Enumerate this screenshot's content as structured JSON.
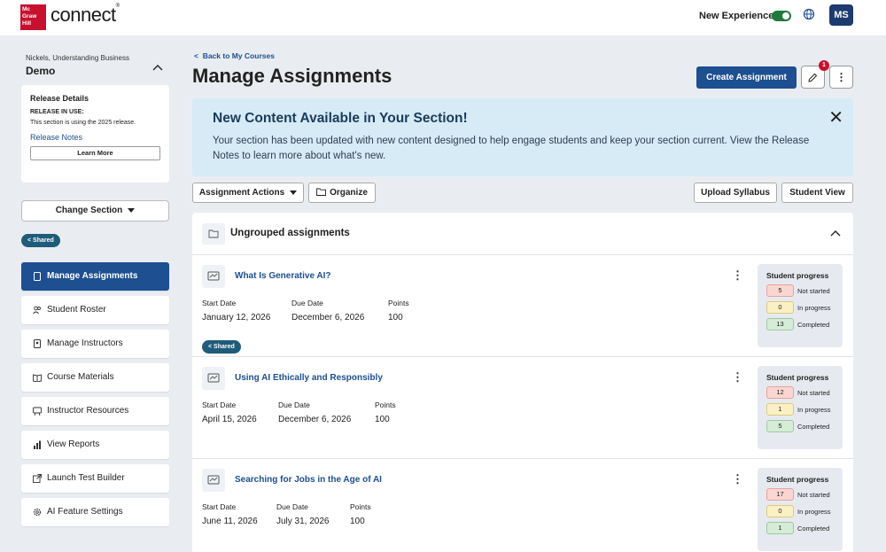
{
  "header": {
    "logo_text": "Mc Graw Hill",
    "brand": "connect",
    "new_experience_label": "New Experience",
    "new_experience_on": true,
    "user_initials": "MS"
  },
  "sidebar": {
    "course_name": "Nickels, Understanding Business",
    "section_name": "Demo",
    "release": {
      "title": "Release Details",
      "in_use_label": "RELEASE IN USE:",
      "in_use_text": "This section is using the 2025 release.",
      "notes_link": "Release Notes",
      "learn_more": "Learn More"
    },
    "change_section": "Change Section",
    "shared_badge": "Shared",
    "items": [
      {
        "label": "Manage Assignments",
        "active": true
      },
      {
        "label": "Student Roster"
      },
      {
        "label": "Manage Instructors"
      },
      {
        "label": "Course Materials"
      },
      {
        "label": "Instructor Resources"
      },
      {
        "label": "View Reports"
      },
      {
        "label": "Launch Test Builder"
      },
      {
        "label": "AI Feature Settings"
      }
    ]
  },
  "main": {
    "back_link": "Back to My Courses",
    "title": "Manage Assignments",
    "create_button": "Create Assignment",
    "notification_count": "1",
    "banner": {
      "title": "New Content Available in Your Section!",
      "body": "Your section has been updated with new content designed to help engage students and keep your section current. View the Release Notes to learn more about what's new."
    },
    "toolbar": {
      "assignment_actions": "Assignment Actions",
      "organize": "Organize",
      "upload_syllabus": "Upload Syllabus",
      "student_view": "Student View"
    },
    "group_title": "Ungrouped assignments",
    "labels": {
      "start_date": "Start Date",
      "due_date": "Due Date",
      "points": "Points",
      "progress_title": "Student progress",
      "not_started": "Not started",
      "in_progress": "In progress",
      "completed": "Completed",
      "shared": "Shared"
    },
    "assignments": [
      {
        "title": "What Is Generative AI?",
        "start": "January 12, 2026",
        "due": "December 6, 2026",
        "points": "100",
        "not_started": "5",
        "in_progress": "0",
        "completed": "13",
        "shared": true
      },
      {
        "title": "Using AI Ethically and Responsibly",
        "start": "April 15, 2026",
        "due": "December 6, 2026",
        "points": "100",
        "not_started": "12",
        "in_progress": "1",
        "completed": "5",
        "shared": false
      },
      {
        "title": "Searching for Jobs in the Age of AI",
        "start": "June 11, 2026",
        "due": "July 31, 2026",
        "points": "100",
        "not_started": "17",
        "in_progress": "0",
        "completed": "1",
        "shared": false
      }
    ]
  }
}
